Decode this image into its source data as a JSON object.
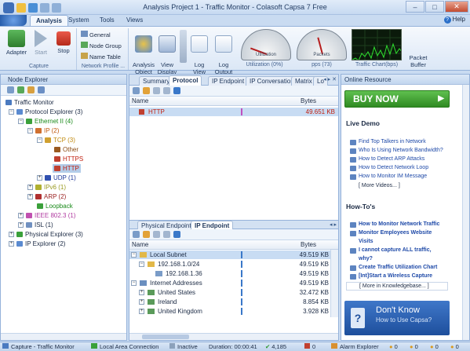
{
  "window": {
    "title": "Analysis Project 1 - Traffic Monitor - Colasoft Capsa 7 Free",
    "minimize": "–",
    "maximize": "□",
    "close": "✕"
  },
  "menu": {
    "tabs": [
      "Analysis",
      "System",
      "Tools",
      "Views"
    ],
    "help": "Help"
  },
  "ribbon": {
    "capture_group": "Capture",
    "adapter": "Adapter",
    "start": "Start",
    "stop": "Stop",
    "profile_group": "Network Profile ...",
    "general": "General",
    "node_group": "Node Group",
    "name_table": "Name Table",
    "analysis_object": "Analysis\nObject",
    "view_display": "View\nDisplay",
    "log_view": "Log\nView",
    "log_output": "Log\nOutput",
    "gauge1": "Utilization (0%)",
    "gauge1_label": "Utilization",
    "gauge2": "pps (73)",
    "gauge2_label": "Packets",
    "chart": "Traffic Chart(bps)",
    "packet_buffer": "Packet\nBuffer",
    "gauge1_value": 0,
    "gauge2_value": 73
  },
  "node_explorer": {
    "title": "Node Explorer",
    "tree": [
      {
        "label": "Traffic Monitor",
        "color": "#1b2a44"
      },
      {
        "label": "Protocol Explorer (3)",
        "color": "#1b2a44"
      },
      {
        "label": "Ethernet II (4)",
        "color": "#1a8a1a"
      },
      {
        "label": "IP (2)",
        "color": "#c05a10"
      },
      {
        "label": "TCP (3)",
        "color": "#c08a10"
      },
      {
        "label": "Other",
        "color": "#8a4a10"
      },
      {
        "label": "HTTPS",
        "color": "#c02010"
      },
      {
        "label": "HTTP",
        "color": "#c02010"
      },
      {
        "label": "UDP (1)",
        "color": "#1f3a9a"
      },
      {
        "label": "IPv6 (1)",
        "color": "#9a9a20"
      },
      {
        "label": "ARP (2)",
        "color": "#9a2020"
      },
      {
        "label": "Loopback",
        "color": "#1a8a1a"
      },
      {
        "label": "IEEE 802.3 (1)",
        "color": "#b03aa0"
      },
      {
        "label": "ISL (1)",
        "color": "#1b2a44"
      },
      {
        "label": "Physical Explorer (3)",
        "color": "#1b2a44"
      },
      {
        "label": "IP Explorer (2)",
        "color": "#1b2a44"
      }
    ]
  },
  "center_top": {
    "tabs": [
      "Summary",
      "Protocol",
      "IP Endpoint",
      "IP Conversation",
      "Matrix",
      "Lo"
    ],
    "col_name": "Name",
    "col_bytes": "Bytes",
    "rows": [
      {
        "name": "HTTP",
        "bytes": "49.651 KB",
        "fraction": 1.0
      }
    ]
  },
  "center_bottom": {
    "tabs": [
      "Physical Endpoint",
      "IP Endpoint"
    ],
    "col_name": "Name",
    "col_bytes": "Bytes",
    "rows": [
      {
        "name": "Local Subnet",
        "bytes": "49.519 KB",
        "fraction": 1.0
      },
      {
        "name": "192.168.1.0/24",
        "bytes": "49.519 KB",
        "fraction": 1.0
      },
      {
        "name": "192.168.1.36",
        "bytes": "49.519 KB",
        "fraction": 1.0
      },
      {
        "name": "Internet Addresses",
        "bytes": "49.519 KB",
        "fraction": 1.0
      },
      {
        "name": "United States",
        "bytes": "32.472 KB",
        "fraction": 0.66
      },
      {
        "name": "Ireland",
        "bytes": "8.854 KB",
        "fraction": 0.18
      },
      {
        "name": "United Kingdom",
        "bytes": "3.928 KB",
        "fraction": 0.08
      }
    ]
  },
  "online": {
    "title": "Online Resource",
    "buy": "BUY NOW",
    "live_demo": "Live Demo",
    "demo_links": [
      "Find Top Talkers in Network",
      "Who Is Using Network Bandwidth?",
      "How to Detect ARP Attacks",
      "How to Detect Network Loop",
      "How to Monitor IM Message"
    ],
    "more_videos": "[ More Videos... ]",
    "howtos": "How-To's",
    "howto_links": [
      "How to Monitor Network Traffic",
      "Monitor Employees Website",
      "Visits",
      "I cannot capture ALL traffic,",
      "why?",
      "Create Traffic Utilization Chart",
      "[Int]Start a Wireless Capture"
    ],
    "more_kb": "[ More in Knowledgebase... ]",
    "dont_know": "Don't Know",
    "how_to_use": "How to Use Capsa?"
  },
  "status": {
    "capture": "Capture - Traffic Monitor",
    "connection": "Local Area Connection",
    "state": "Inactive",
    "duration": "Duration: 00:00:41",
    "packets": "4,185",
    "count2": "0",
    "alarm": "Alarm Explorer",
    "a1": "0",
    "a2": "0",
    "a3": "0",
    "a4": "0"
  },
  "colors": {
    "ribbon_bg": "#dbe7f6",
    "accent": "#2a6fc9",
    "buy_green": "#3a9a2a",
    "selected_row": "#c8dcf3"
  }
}
